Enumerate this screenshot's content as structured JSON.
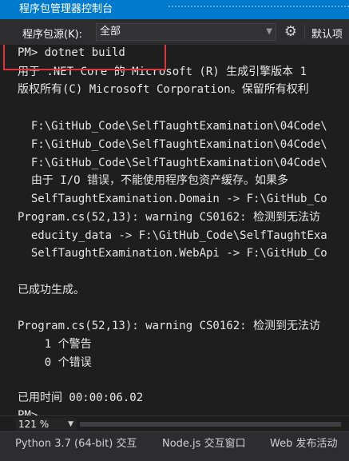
{
  "window": {
    "title": "程序包管理器控制台"
  },
  "toolbar": {
    "source_label": "程序包源(K):",
    "source_value": "全部",
    "settings_icon": "gear-icon",
    "default_project_label": "默认项"
  },
  "console": {
    "lines": [
      "PM> dotnet build",
      "用于 .NET Core 的 Microsoft (R) 生成引擎版本 1",
      "版权所有(C) Microsoft Corporation。保留所有权利",
      "",
      "  F:\\GitHub_Code\\SelfTaughtExamination\\04Code\\",
      "  F:\\GitHub_Code\\SelfTaughtExamination\\04Code\\",
      "  F:\\GitHub_Code\\SelfTaughtExamination\\04Code\\",
      "  由于 I/O 错误，不能使用程序包资产缓存。如果多",
      "  SelfTaughtExamination.Domain -> F:\\GitHub_Co",
      "Program.cs(52,13): warning CS0162: 检测到无法访",
      "  educity_data -> F:\\GitHub_Code\\SelfTaughtExa",
      "  SelfTaughtExamination.WebApi -> F:\\GitHub_Co",
      "",
      "已成功生成。",
      "",
      "Program.cs(52,13): warning CS0162: 检测到无法访",
      "    1 个警告",
      "    0 个错误",
      "",
      "已用时间 00:00:06.02",
      "PM>"
    ]
  },
  "zoom": {
    "value": "121 %"
  },
  "bottom_tabs": [
    "Python 3.7 (64-bit) 交互",
    "Node.js 交互窗口",
    "Web 发布活动"
  ]
}
